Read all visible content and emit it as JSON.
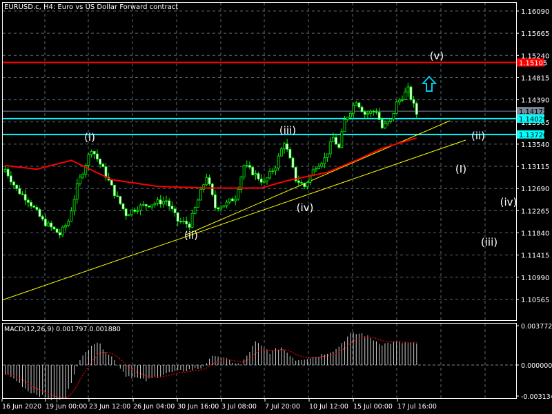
{
  "chart_data": {
    "type": "candlestick",
    "title": "EURUSD.c, H4:  Euro vs US Dollar Forward contract",
    "symbol": "EURUSD.c",
    "timeframe": "H4",
    "y_ticks": [
      "1.16090",
      "1.15665",
      "1.15240",
      "1.14815",
      "1.14390",
      "1.13965",
      "1.13540",
      "1.13115",
      "1.12690",
      "1.12265",
      "1.11840",
      "1.11415",
      "1.10990",
      "1.10565"
    ],
    "ylim": [
      1.1025,
      1.163
    ],
    "x_ticks": [
      "16 Jun 2020",
      "19 Jun 00:00",
      "23 Jun 12:00",
      "26 Jun 04:00",
      "30 Jun 16:00",
      "3 Jul 08:00",
      "7 Jul 20:00",
      "10 Jul 12:00",
      "15 Jul 00:00",
      "17 Jul 16:00"
    ],
    "candle_count": 144,
    "close_keypoints": [
      [
        0,
        1.1306
      ],
      [
        4,
        1.1267
      ],
      [
        8,
        1.1247
      ],
      [
        13,
        1.1207
      ],
      [
        19,
        1.1181
      ],
      [
        22,
        1.1207
      ],
      [
        25,
        1.1273
      ],
      [
        30,
        1.1346
      ],
      [
        34,
        1.1306
      ],
      [
        38,
        1.126
      ],
      [
        42,
        1.122
      ],
      [
        46,
        1.1233
      ],
      [
        51,
        1.124
      ],
      [
        56,
        1.1246
      ],
      [
        60,
        1.1207
      ],
      [
        64,
        1.12
      ],
      [
        70,
        1.1293
      ],
      [
        73,
        1.1233
      ],
      [
        77,
        1.124
      ],
      [
        80,
        1.1253
      ],
      [
        83,
        1.1313
      ],
      [
        86,
        1.13
      ],
      [
        90,
        1.128
      ],
      [
        94,
        1.1313
      ],
      [
        97,
        1.1359
      ],
      [
        101,
        1.1287
      ],
      [
        104,
        1.1273
      ],
      [
        108,
        1.1313
      ],
      [
        111,
        1.1326
      ],
      [
        114,
        1.1366
      ],
      [
        116,
        1.1346
      ],
      [
        118,
        1.1399
      ],
      [
        122,
        1.1438
      ],
      [
        125,
        1.1412
      ],
      [
        129,
        1.1418
      ],
      [
        131,
        1.1385
      ],
      [
        134,
        1.1399
      ],
      [
        136,
        1.1432
      ],
      [
        140,
        1.1458
      ],
      [
        143,
        1.1412
      ]
    ],
    "moving_average": {
      "color": "#ff0000",
      "keypoints": [
        [
          0,
          1.1313
        ],
        [
          11,
          1.1306
        ],
        [
          23,
          1.1323
        ],
        [
          37,
          1.1286
        ],
        [
          53,
          1.1273
        ],
        [
          70,
          1.127
        ],
        [
          89,
          1.127
        ],
        [
          98,
          1.1284
        ],
        [
          112,
          1.13
        ],
        [
          122,
          1.1323
        ],
        [
          131,
          1.1346
        ],
        [
          143,
          1.1366
        ]
      ]
    },
    "horizontal_levels": [
      {
        "price": "1.15105",
        "color": "#ff0000"
      },
      {
        "price": "1.14172",
        "color": "#778899"
      },
      {
        "price": "1.14029",
        "color": "#00ffff"
      },
      {
        "price": "1.13726",
        "color": "#00ffff"
      }
    ],
    "wave_labels": [
      "(v)",
      "(i)",
      "(iii)",
      "(ii)",
      "(I)",
      "(iv)",
      "(iv)",
      "(ii)",
      "(iii)"
    ],
    "indicator": {
      "label": "MACD(12,26,9) 0.001797 0.001880",
      "y_ticks": [
        "0.003772",
        "0.000000",
        "-0.003134"
      ],
      "ylim": [
        -0.003134,
        0.003772
      ],
      "histogram_keypoints": [
        [
          0,
          -0.0008
        ],
        [
          4,
          -0.0015
        ],
        [
          8,
          -0.0025
        ],
        [
          13,
          -0.003
        ],
        [
          18,
          -0.0035
        ],
        [
          21,
          -0.0032
        ],
        [
          25,
          0.0
        ],
        [
          30,
          0.002
        ],
        [
          32,
          0.0022
        ],
        [
          37,
          0.0008
        ],
        [
          42,
          -0.001
        ],
        [
          49,
          -0.0015
        ],
        [
          56,
          -0.0008
        ],
        [
          63,
          -0.0005
        ],
        [
          68,
          -0.0003
        ],
        [
          73,
          0.001
        ],
        [
          77,
          0.0005
        ],
        [
          82,
          0.0
        ],
        [
          87,
          0.0022
        ],
        [
          92,
          0.0012
        ],
        [
          96,
          0.0017
        ],
        [
          101,
          0.0005
        ],
        [
          108,
          0.0008
        ],
        [
          115,
          0.0015
        ],
        [
          120,
          0.003
        ],
        [
          124,
          0.003
        ],
        [
          131,
          0.002
        ],
        [
          136,
          0.0022
        ],
        [
          143,
          0.002
        ]
      ],
      "signal_color": "#ff0000"
    }
  }
}
